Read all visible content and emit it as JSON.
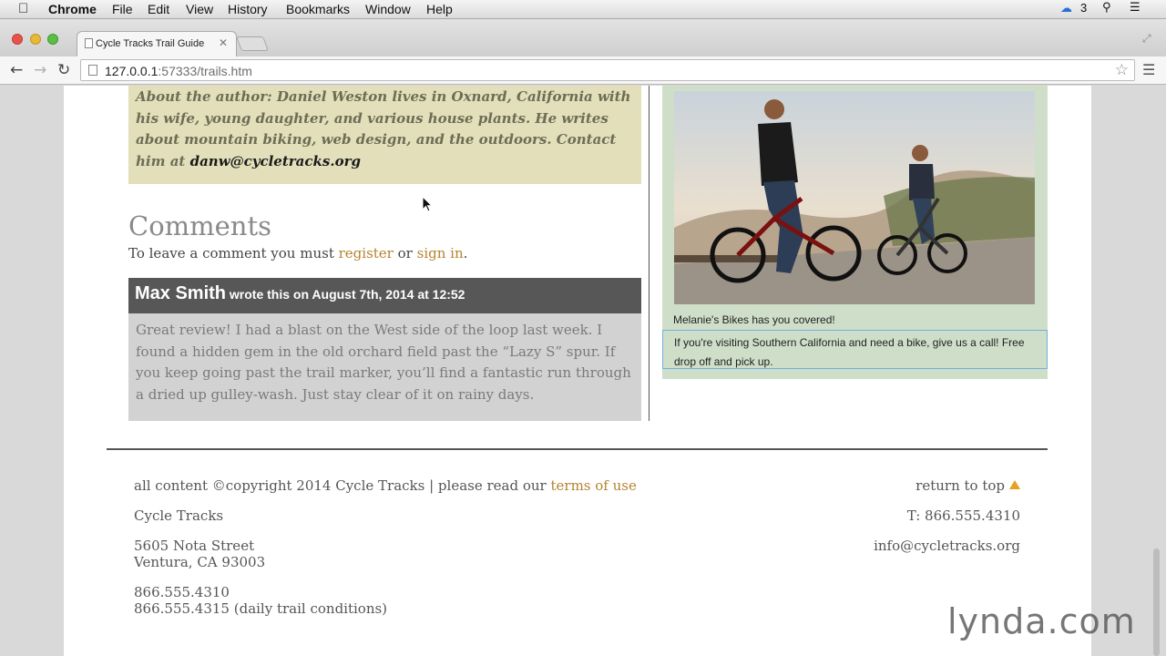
{
  "menubar": {
    "app": "Chrome",
    "items": [
      "File",
      "Edit",
      "View",
      "History",
      "Bookmarks",
      "Window",
      "Help"
    ],
    "badge_count": "3"
  },
  "tab": {
    "title": "Cycle Tracks Trail Guide"
  },
  "omnibox": {
    "host": "127.0.0.1",
    "path": ":57333/trails.htm"
  },
  "author": {
    "text": "About the author: Daniel Weston lives in Oxnard, California with his wife, young daughter, and various house plants. He writes about mountain biking, web design, and the outdoors. Contact him at",
    "email": "danw@cycletracks.org"
  },
  "comments": {
    "heading": "Comments",
    "prompt_prefix": "To leave a comment you must",
    "register": "register",
    "or": "or",
    "sign_in": "sign in",
    "period": "."
  },
  "comment": {
    "author": "Max Smith",
    "meta": "wrote this on August 7th, 2014 at 12:52",
    "body": "Great review! I had a blast on the West side of the loop last week. I found a hidden gem in the old orchard field past the “Lazy S” spur. If you keep going past the trail marker, you’ll find a fantastic run through a dried up gulley-wash. Just stay clear of it on rainy days."
  },
  "sidebar": {
    "ad_title": "Melanie's Bikes has you covered!",
    "ad_text": "If you're visiting Southern California and need a bike, give us a call! Free drop off and pick up."
  },
  "footer": {
    "copyright_prefix": "all content ©copyright 2014 Cycle Tracks | please read our",
    "terms_link": "terms of use",
    "company": "Cycle Tracks",
    "address_line1": "5605 Nota Street",
    "address_line2": "Ventura, CA 93003",
    "phone1": "866.555.4310",
    "phone2": "866.555.4315 (daily trail conditions)",
    "return_top": "return to top",
    "phone_right": "T: 866.555.4310",
    "email": "info@cycletracks.org"
  },
  "watermark": {
    "brand": "lynda",
    "suffix": ".com"
  },
  "colors": {
    "link": "#b5832e",
    "author_bg": "#e2dfba",
    "sidebar_bg": "#cfdec9",
    "comment_head_bg": "#575757",
    "accent_triangle": "#e7a024"
  }
}
